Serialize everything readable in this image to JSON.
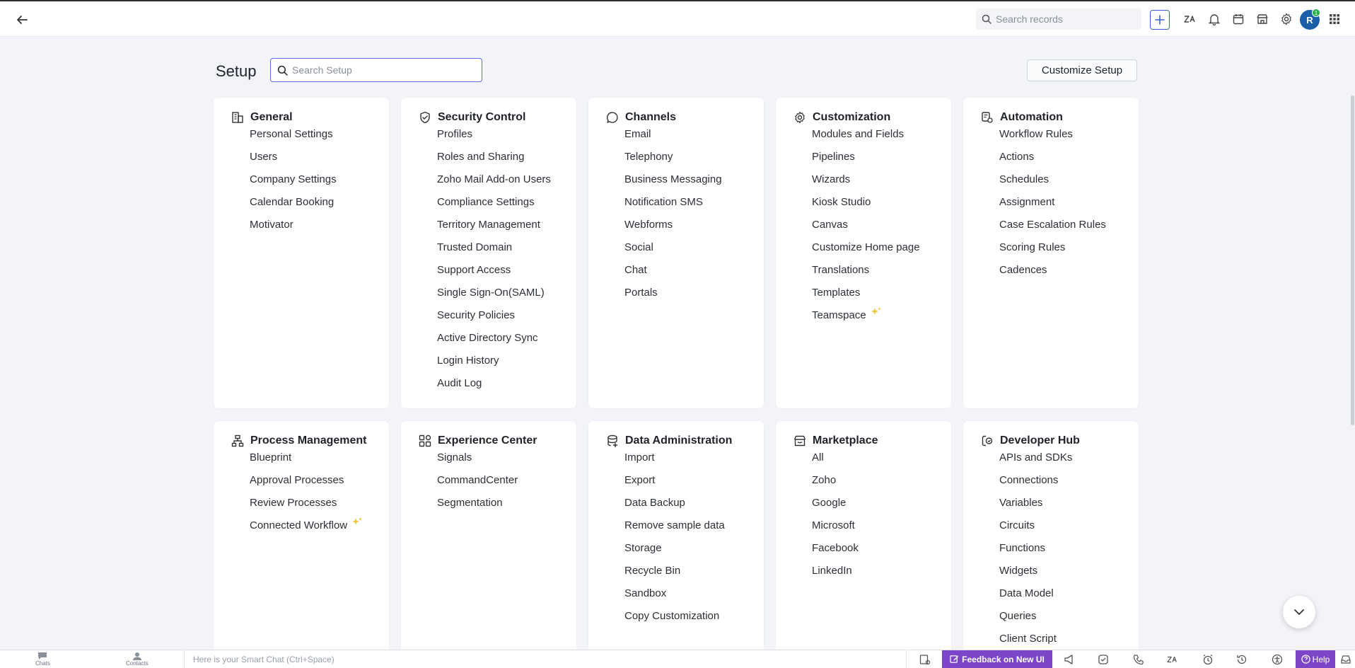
{
  "topbar": {
    "search_placeholder": "Search records",
    "avatar_initial": "R",
    "avatar_badge": "1"
  },
  "setup": {
    "title": "Setup",
    "search_placeholder": "Search Setup",
    "customize_label": "Customize Setup"
  },
  "cards": {
    "general": {
      "title": "General",
      "items": [
        "Personal Settings",
        "Users",
        "Company Settings",
        "Calendar Booking",
        "Motivator"
      ]
    },
    "security": {
      "title": "Security Control",
      "items": [
        "Profiles",
        "Roles and Sharing",
        "Zoho Mail Add-on Users",
        "Compliance Settings",
        "Territory Management",
        "Trusted Domain",
        "Support Access",
        "Single Sign-On(SAML)",
        "Security Policies",
        "Active Directory Sync",
        "Login History",
        "Audit Log"
      ]
    },
    "channels": {
      "title": "Channels",
      "items": [
        "Email",
        "Telephony",
        "Business Messaging",
        "Notification SMS",
        "Webforms",
        "Social",
        "Chat",
        "Portals"
      ]
    },
    "customization": {
      "title": "Customization",
      "items": [
        "Modules and Fields",
        "Pipelines",
        "Wizards",
        "Kiosk Studio",
        "Canvas",
        "Customize Home page",
        "Translations",
        "Templates",
        "Teamspace"
      ]
    },
    "automation": {
      "title": "Automation",
      "items": [
        "Workflow Rules",
        "Actions",
        "Schedules",
        "Assignment",
        "Case Escalation Rules",
        "Scoring Rules",
        "Cadences"
      ]
    },
    "process": {
      "title": "Process Management",
      "items": [
        "Blueprint",
        "Approval Processes",
        "Review Processes",
        "Connected Workflow"
      ]
    },
    "experience": {
      "title": "Experience Center",
      "items": [
        "Signals",
        "CommandCenter",
        "Segmentation"
      ]
    },
    "data_admin": {
      "title": "Data Administration",
      "items": [
        "Import",
        "Export",
        "Data Backup",
        "Remove sample data",
        "Storage",
        "Recycle Bin",
        "Sandbox",
        "Copy Customization"
      ]
    },
    "marketplace": {
      "title": "Marketplace",
      "items": [
        "All",
        "Zoho",
        "Google",
        "Microsoft",
        "Facebook",
        "LinkedIn"
      ]
    },
    "developer": {
      "title": "Developer Hub",
      "items": [
        "APIs and SDKs",
        "Connections",
        "Variables",
        "Circuits",
        "Functions",
        "Widgets",
        "Data Model",
        "Queries",
        "Client Script"
      ]
    }
  },
  "bottombar": {
    "chats_label": "Chats",
    "contacts_label": "Contacts",
    "smart_chat_placeholder": "Here is your Smart Chat (Ctrl+Space)",
    "feedback_label": "Feedback on New UI",
    "help_label": "Help"
  },
  "colors": {
    "accent": "#5a6cd6",
    "feedback_bg": "#7d45c8",
    "avatar_bg": "#1b5eaa",
    "sparkle": "#f2c230"
  }
}
